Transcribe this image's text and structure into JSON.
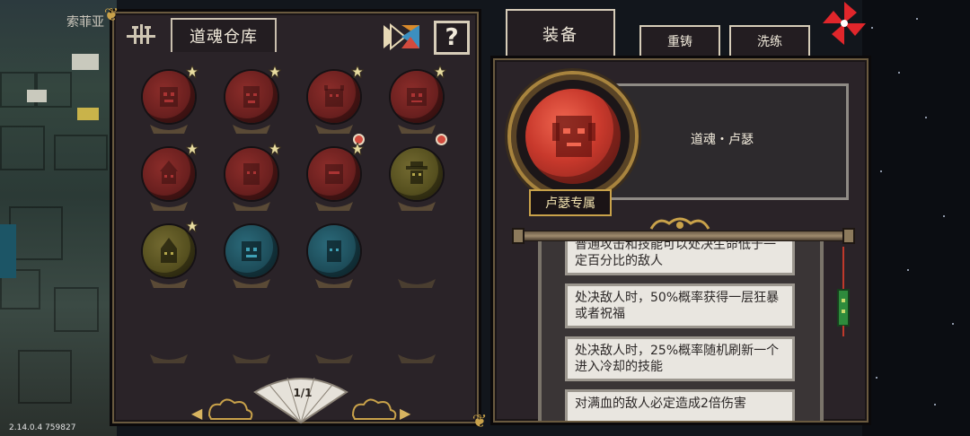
{
  "background": {
    "player_name": "索菲亚",
    "version": "2.14.0.4 759827"
  },
  "storage": {
    "title": "道魂仓库",
    "help_label": "?",
    "slots": [
      {
        "color": "red",
        "star": true,
        "new": false
      },
      {
        "color": "red",
        "star": true,
        "new": false
      },
      {
        "color": "red",
        "star": true,
        "new": true
      },
      {
        "color": "red",
        "star": true,
        "new": true
      },
      {
        "color": "red",
        "star": true,
        "new": false
      },
      {
        "color": "red",
        "star": true,
        "new": false
      },
      {
        "color": "red",
        "star": true,
        "new": false
      },
      {
        "color": "yellow",
        "star": false,
        "new": false
      },
      {
        "color": "yellow",
        "star": true,
        "new": false
      },
      {
        "color": "teal",
        "star": false,
        "new": false
      },
      {
        "color": "teal",
        "star": false,
        "new": false
      }
    ],
    "page_indicator": "1/1",
    "prev_label": "◀",
    "next_label": "▶"
  },
  "equipment": {
    "tabs": {
      "equip": "装备",
      "reforge": "重铸",
      "refine": "洗练"
    },
    "soul_name": "道魂・卢瑟",
    "exclusive_label": "卢瑟专属",
    "effects": [
      "普通攻击和技能可以处决生命低于一定百分比的敌人",
      "处决敌人时，50%概率获得一层狂暴或者祝福",
      "处决敌人时，25%概率随机刷新一个进入冷却的技能",
      "对满血的敌人必定造成2倍伤害"
    ]
  },
  "colors": {
    "panel_bg": "#2a2328",
    "gold_trim": "#c9a24a",
    "red_orb": "#c8392c",
    "yellow_orb": "#56501f",
    "teal_orb": "#1e4e5b",
    "close_red": "#e0262b"
  }
}
